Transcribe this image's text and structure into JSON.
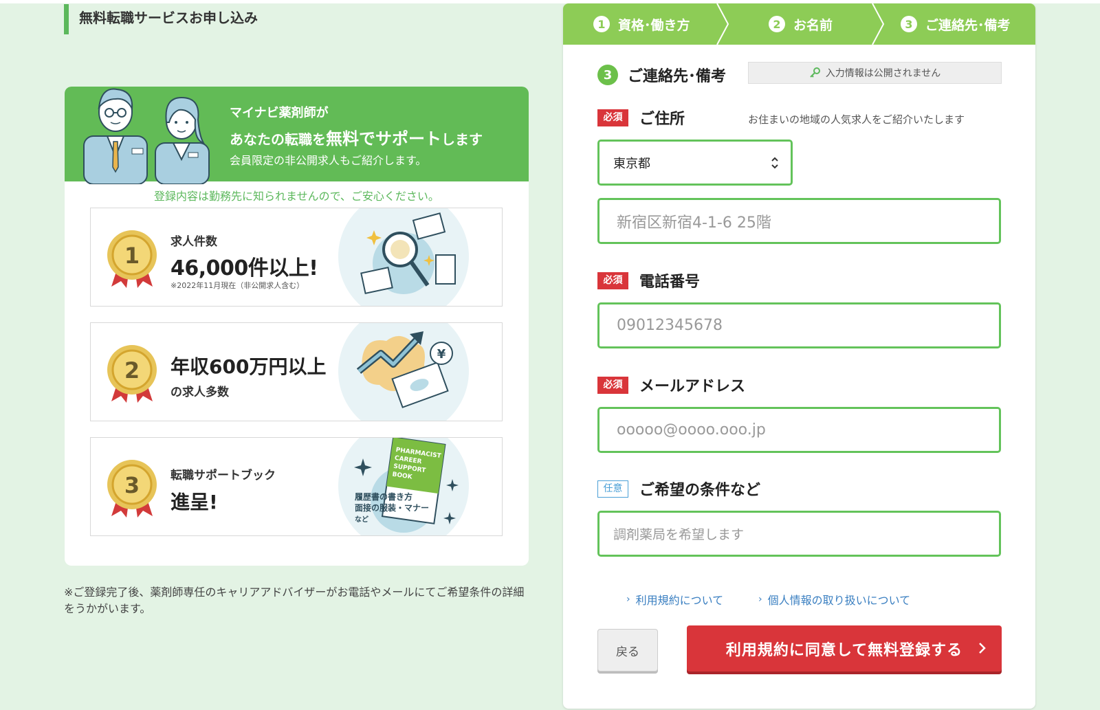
{
  "page": {
    "heading": "無料転職サービスお申し込み"
  },
  "promo": {
    "line1": "マイナビ薬剤師が",
    "line2_pre": "あなたの転職を",
    "line2_em": "無料でサポート",
    "line2_post": "します",
    "line3": "会員限定の非公開求人もご紹介します。",
    "note": "登録内容は勤務先に知られませんので、ご安心ください。",
    "features": [
      {
        "rank": "1",
        "label": "求人件数",
        "big": "46,000件以上!",
        "small": "※2022年11月現在（非公開求人含む）"
      },
      {
        "rank": "2",
        "big": "年収600万円以上",
        "small": "の求人多数"
      },
      {
        "rank": "3",
        "label": "転職サポートブック",
        "big": "進呈!",
        "book_title": "PHARMACIST CAREER SUPPORT BOOK",
        "book_line1": "履歴書の書き方",
        "book_line2": "面接の服装・マナー",
        "book_line3": "など"
      }
    ],
    "footnote": "※ご登録完了後、薬剤師専任のキャリアアドバイザーがお電話やメールにてご希望条件の詳細をうかがいます。"
  },
  "steps": [
    {
      "num": "1",
      "label": "資格･働き方"
    },
    {
      "num": "2",
      "label": "お名前"
    },
    {
      "num": "3",
      "label": "ご連絡先･備考"
    }
  ],
  "form": {
    "section_num": "3",
    "section_title": "ご連絡先･備考",
    "privacy": "入力情報は公開されません",
    "required_badge": "必須",
    "optional_badge": "任意",
    "address": {
      "label": "ご住所",
      "hint": "お住まいの地域の人気求人をご紹介いたします",
      "prefecture": "東京都",
      "placeholder": "新宿区新宿4-1-6 25階"
    },
    "phone": {
      "label": "電話番号",
      "placeholder": "09012345678"
    },
    "email": {
      "label": "メールアドレス",
      "placeholder": "ooooo@oooo.ooo.jp"
    },
    "wishes": {
      "label": "ご希望の条件など",
      "placeholder": "調剤薬局を希望します"
    },
    "links": {
      "terms": "利用規約について",
      "privacy": "個人情報の取り扱いについて"
    },
    "back_label": "戻る",
    "submit_label": "利用規約に同意して無料登録する"
  },
  "colors": {
    "green": "#62bb56",
    "step_green": "#8dcc56",
    "red": "#d9353a",
    "link_blue": "#3a7fc1"
  }
}
